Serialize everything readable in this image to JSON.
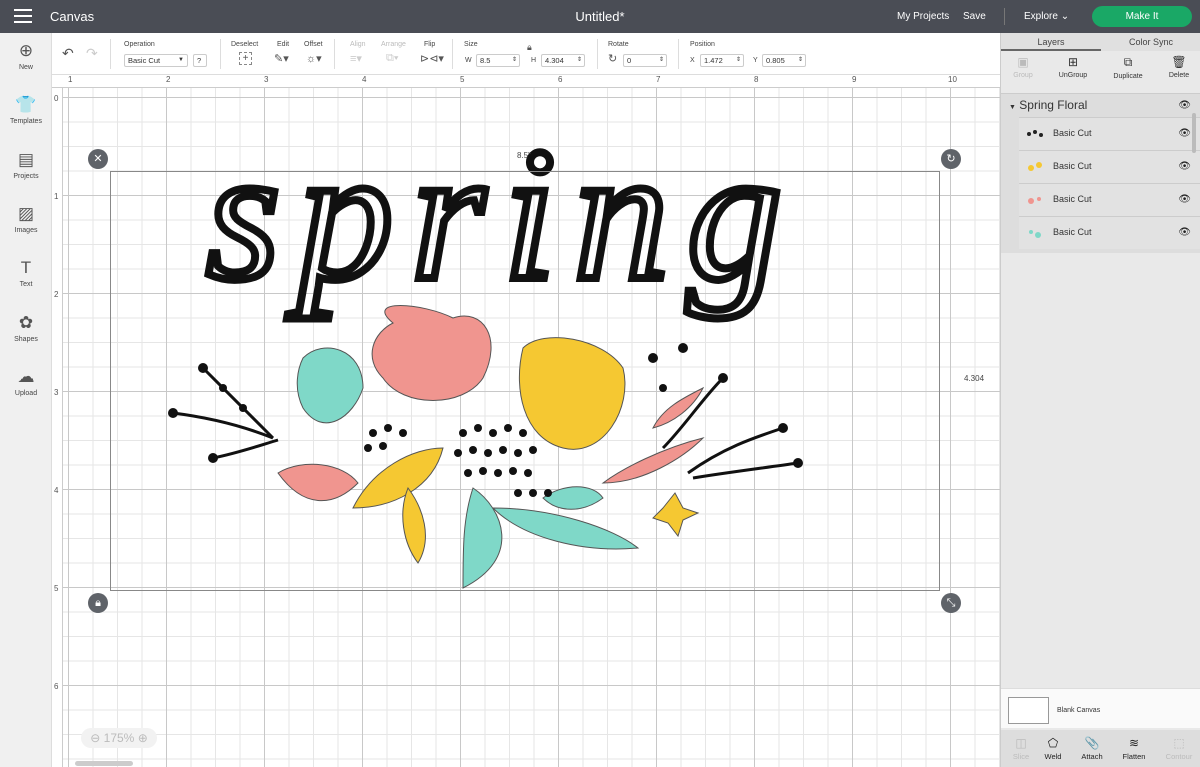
{
  "topbar": {
    "app": "Canvas",
    "title": "Untitled*",
    "my_projects": "My Projects",
    "save": "Save",
    "explore": "Explore",
    "make_it": "Make It"
  },
  "leftnav": [
    {
      "label": "New",
      "icon": "⊕"
    },
    {
      "label": "Templates",
      "icon": "👕"
    },
    {
      "label": "Projects",
      "icon": "▤"
    },
    {
      "label": "Images",
      "icon": "▨"
    },
    {
      "label": "Text",
      "icon": "T"
    },
    {
      "label": "Shapes",
      "icon": "✿"
    },
    {
      "label": "Upload",
      "icon": "☁"
    }
  ],
  "toolbar": {
    "operation_label": "Operation",
    "operation_value": "Basic Cut",
    "help": "?",
    "deselect": "Deselect",
    "edit": "Edit",
    "offset": "Offset",
    "align": "Align",
    "arrange": "Arrange",
    "flip": "Flip",
    "size": "Size",
    "w_label": "W",
    "w": "8.5",
    "h_label": "H",
    "h": "4.304",
    "rotate": "Rotate",
    "rotate_value": "0",
    "position": "Position",
    "x_label": "X",
    "x": "1.472",
    "y_label": "Y",
    "y": "0.805"
  },
  "ruler": {
    "top": [
      "1",
      "2",
      "3",
      "4",
      "5",
      "6",
      "7",
      "8",
      "9",
      "10"
    ],
    "left": [
      "0",
      "1",
      "2",
      "3",
      "4",
      "5",
      "6"
    ]
  },
  "canvas": {
    "width_label": "8.5\"",
    "height_label": "4.304",
    "zoom": "175%",
    "artwork_text": "spring"
  },
  "panel": {
    "tabs": [
      "Layers",
      "Color Sync"
    ],
    "actions": [
      {
        "label": "Group",
        "enabled": false,
        "icon": "▣"
      },
      {
        "label": "UnGroup",
        "enabled": true,
        "icon": "⊞"
      },
      {
        "label": "Duplicate",
        "enabled": true,
        "icon": "⧉"
      },
      {
        "label": "Delete",
        "enabled": true,
        "icon": "🗑"
      }
    ],
    "group_name": "Spring Floral",
    "layers": [
      {
        "label": "Basic Cut",
        "color": "#222222"
      },
      {
        "label": "Basic Cut",
        "color": "#f5c832"
      },
      {
        "label": "Basic Cut",
        "color": "#f0958f"
      },
      {
        "label": "Basic Cut",
        "color": "#7fd8c8"
      }
    ],
    "blank_canvas": "Blank Canvas",
    "bottom": [
      {
        "label": "Slice",
        "enabled": false,
        "icon": "◫"
      },
      {
        "label": "Weld",
        "enabled": true,
        "icon": "⬠"
      },
      {
        "label": "Attach",
        "enabled": true,
        "icon": "📎"
      },
      {
        "label": "Flatten",
        "enabled": true,
        "icon": "≋"
      },
      {
        "label": "Contour",
        "enabled": false,
        "icon": "⬚"
      }
    ]
  },
  "colors": {
    "topbar": "#4a4d55",
    "make_it": "#1aa866",
    "pink": "#f0958f",
    "yellow": "#f5c832",
    "teal": "#7fd8c8",
    "black": "#111111"
  }
}
